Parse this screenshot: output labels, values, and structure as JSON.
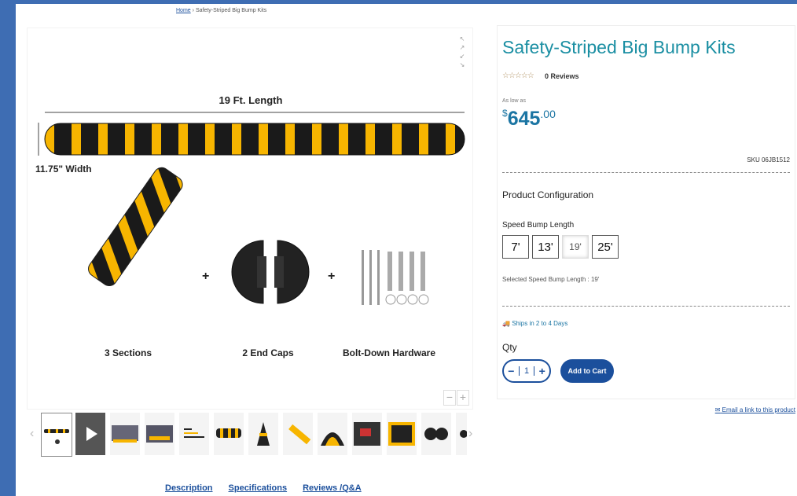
{
  "breadcrumb": {
    "home": "Home",
    "separator": "›",
    "current": "Safety-Striped Big Bump Kits"
  },
  "gallery": {
    "length_label": "19 Ft. Length",
    "width_label": "11.75\" Width",
    "items": [
      "3 Sections",
      "2 End Caps",
      "Bolt-Down Hardware"
    ],
    "plus": "+",
    "expand_icon": "↖ ↗ ↙ ↘",
    "zoom_out": "−",
    "zoom_in": "+"
  },
  "thumbs_nav": {
    "prev": "‹",
    "next": "›"
  },
  "product": {
    "title": "Safety-Striped Big Bump Kits",
    "stars": "☆☆☆☆☆",
    "reviews": "0 Reviews",
    "as_low_as": "As low as",
    "price_currency": "$",
    "price_dollars": "645",
    "price_cents": ".00",
    "sku": "SKU 06JB1512",
    "config_title": "Product Configuration",
    "speed_bump_label": "Speed Bump Length",
    "options": [
      "7'",
      "13'",
      "19'",
      "25'"
    ],
    "selected_text": "Selected Speed Bump Length : 19'",
    "ships": "Ships in 2 to 4 Days",
    "qty_label": "Qty",
    "qty_minus": "−",
    "qty_value": "1",
    "qty_plus": "+",
    "add_to_cart": "Add to Cart",
    "email_link": "Email a link to this product"
  },
  "tabs": [
    "Description",
    "Specifications",
    "Reviews /Q&A"
  ],
  "colors": {
    "page_bg": "#3e6db3",
    "title": "#1b8fa3",
    "price": "#1b75a3",
    "button": "#1b4f9c",
    "stripe_yellow": "#f7b500"
  }
}
